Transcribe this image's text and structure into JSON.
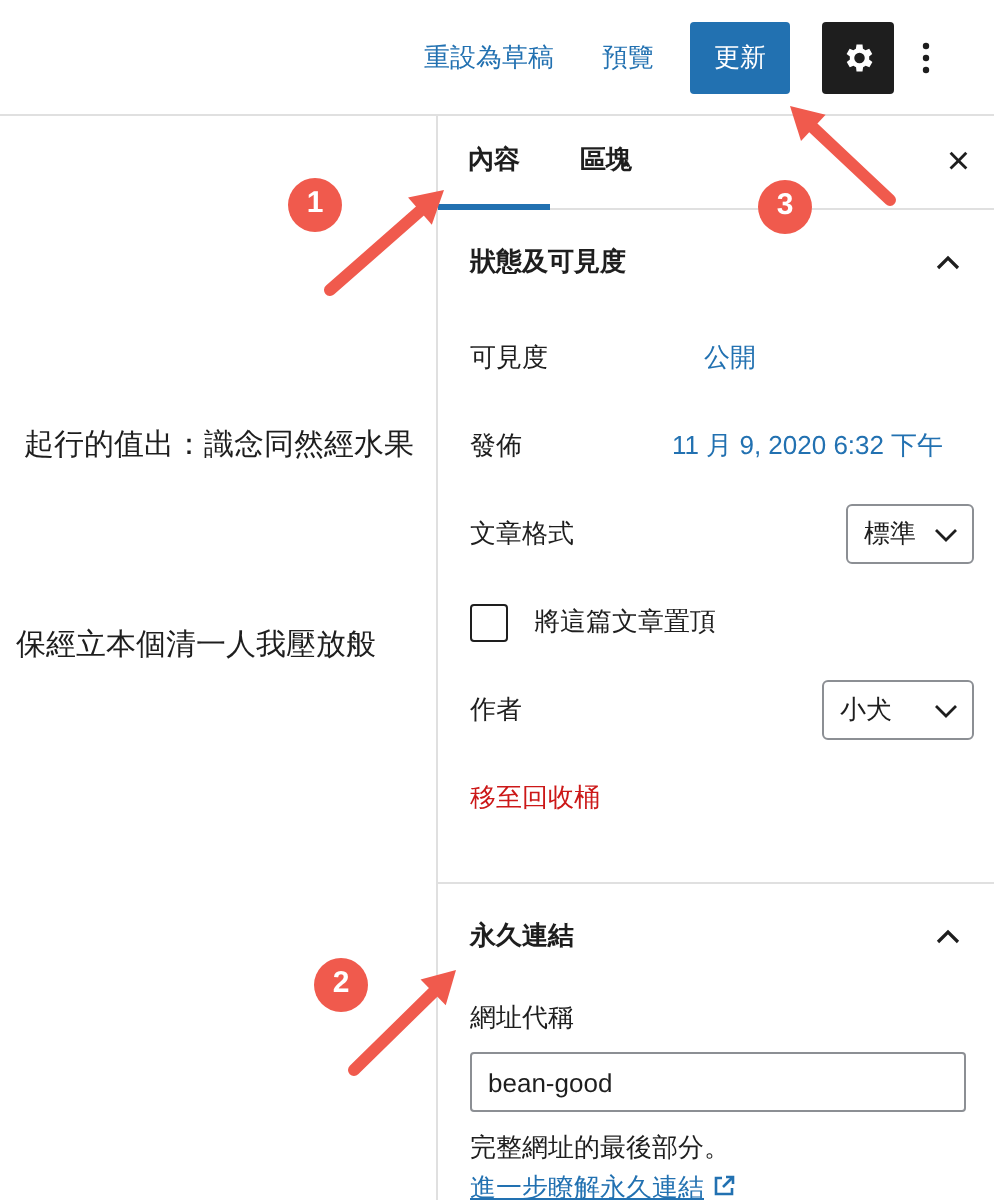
{
  "top_bar": {
    "actions": [
      {
        "kind": "link",
        "label": "重設為草稿"
      },
      {
        "kind": "link",
        "label": "預覽"
      },
      {
        "kind": "primary",
        "label": "更新"
      }
    ],
    "settings": {
      "selected": true
    }
  },
  "editor": {
    "paragraphs": [
      "起行的值出：識念同然經水果",
      "保經立本個清一人我壓放般"
    ]
  },
  "sidebar": {
    "tabs": [
      {
        "label": "內容",
        "selected": true
      },
      {
        "label": "區塊",
        "selected": false
      }
    ],
    "close": "×",
    "status_panel": {
      "title": "狀態及可見度",
      "expanded": true,
      "rows": [
        {
          "kind": "link",
          "label": "可見度",
          "value": "公開"
        },
        {
          "kind": "link",
          "label": "發佈",
          "value": "11 月 9, 2020 6:32 下午"
        },
        {
          "kind": "select",
          "label": "文章格式",
          "value": "標準"
        },
        {
          "kind": "checkbox",
          "label": "將這篇文章置頂",
          "checked": false
        },
        {
          "kind": "select",
          "label": "作者",
          "value": "小犬"
        },
        {
          "kind": "danger",
          "label": "移至回收桶"
        }
      ]
    },
    "permalink_panel": {
      "title": "永久連結",
      "expanded": true,
      "field_label": "網址代稱",
      "value": "bean-good",
      "help": "完整網址的最後部分。",
      "help_link": "進一步瞭解永久連結"
    }
  },
  "annotations": [
    {
      "number": "1"
    },
    {
      "number": "2"
    },
    {
      "number": "3"
    }
  ]
}
